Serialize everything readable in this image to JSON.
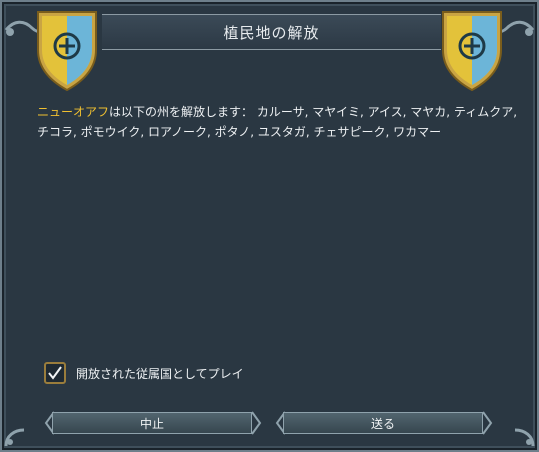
{
  "dialog": {
    "title": "植民地の解放"
  },
  "message": {
    "country": "ニューオアフ",
    "text": "は以下の州を解放します： カルーサ, マヤイミ, アイス, マヤカ, ティムクア, チコラ, ポモウイク, ロアノーク, ポタノ, ユスタガ, チェサピーク, ワカマー"
  },
  "option": {
    "label": "開放された従属国としてプレイ",
    "checked": true
  },
  "buttons": {
    "cancel": "中止",
    "send": "送る"
  },
  "colors": {
    "shield_blue": "#6cb5d8",
    "shield_gold": "#e3c23a",
    "country_highlight": "#f0c030"
  }
}
